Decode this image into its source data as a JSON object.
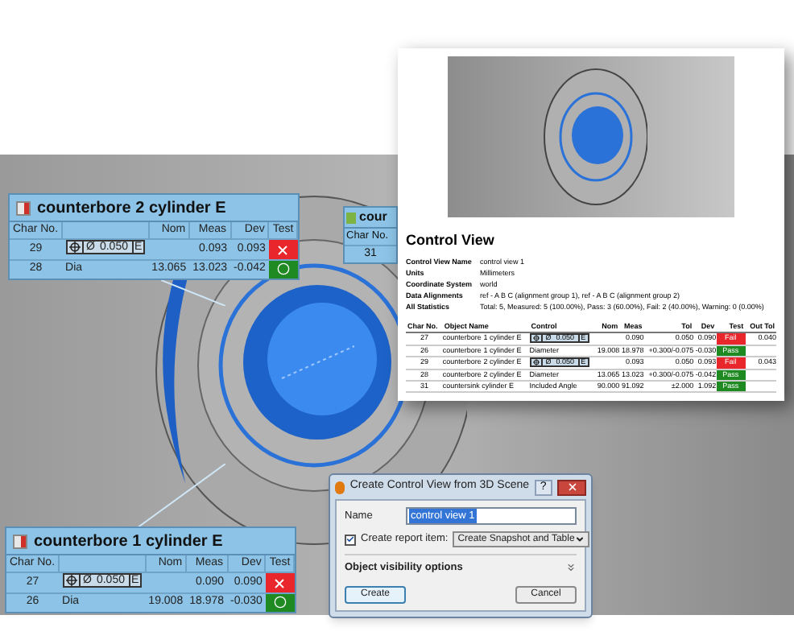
{
  "callouts": [
    {
      "title": "counterbore 2 cylinder E",
      "columns": [
        "Char No.",
        "",
        "Nom",
        "Meas",
        "Dev",
        "Test"
      ],
      "rows": [
        {
          "char": "29",
          "control": {
            "kind": "frame",
            "symbol": "Ø",
            "tolerance": "0.050",
            "modifier": "E"
          },
          "nom": "",
          "meas": "0.093",
          "dev": "0.093",
          "passed": false
        },
        {
          "char": "28",
          "control": {
            "kind": "text",
            "text": "Dia"
          },
          "nom": "13.065",
          "meas": "13.023",
          "dev": "-0.042",
          "passed": true
        }
      ]
    },
    {
      "title": "counterbore 1 cylinder E",
      "columns": [
        "Char No.",
        "",
        "Nom",
        "Meas",
        "Dev",
        "Test"
      ],
      "rows": [
        {
          "char": "27",
          "control": {
            "kind": "frame",
            "symbol": "Ø",
            "tolerance": "0.050",
            "modifier": "E"
          },
          "nom": "",
          "meas": "0.090",
          "dev": "0.090",
          "passed": false
        },
        {
          "char": "26",
          "control": {
            "kind": "text",
            "text": "Dia"
          },
          "nom": "19.008",
          "meas": "18.978",
          "dev": "-0.030",
          "passed": true
        }
      ]
    }
  ],
  "partial_callout": {
    "title": "cour",
    "column": "Char No.",
    "value": "31"
  },
  "report": {
    "heading": "Control View",
    "info": [
      {
        "label": "Control View Name",
        "value": "control view 1"
      },
      {
        "label": "Units",
        "value": "Millimeters"
      },
      {
        "label": "Coordinate System",
        "value": "world"
      },
      {
        "label": "Data Alignments",
        "value": "ref - A B C (alignment group 1), ref - A B C (alignment group 2)"
      },
      {
        "label": "All Statistics",
        "value": "Total: 5, Measured: 5 (100.00%), Pass: 3 (60.00%), Fail: 2 (40.00%), Warning: 0 (0.00%)"
      }
    ],
    "columns": [
      "Char No.",
      "Object Name",
      "Control",
      "Nom",
      "Meas",
      "Tol",
      "Dev",
      "Test",
      "Out Tol"
    ],
    "rows": [
      {
        "char": "27",
        "object": "counterbore 1 cylinder E",
        "control": {
          "kind": "frame",
          "symbol": "Ø",
          "tolerance": "0.050",
          "modifier": "E"
        },
        "nom": "",
        "meas": "0.090",
        "tol": "0.050",
        "dev": "0.090",
        "test": "Fail",
        "passed": false,
        "out_tol": "0.040"
      },
      {
        "char": "26",
        "object": "counterbore 1 cylinder E",
        "control": {
          "kind": "text",
          "text": "Diameter"
        },
        "nom": "19.008",
        "meas": "18.978",
        "tol": "+0.300/-0.075",
        "dev": "-0.030",
        "test": "Pass",
        "passed": true,
        "out_tol": ""
      },
      {
        "char": "29",
        "object": "counterbore 2 cylinder E",
        "control": {
          "kind": "frame",
          "symbol": "Ø",
          "tolerance": "0.050",
          "modifier": "E"
        },
        "nom": "",
        "meas": "0.093",
        "tol": "0.050",
        "dev": "0.093",
        "test": "Fail",
        "passed": false,
        "out_tol": "0.043"
      },
      {
        "char": "28",
        "object": "counterbore 2 cylinder E",
        "control": {
          "kind": "text",
          "text": "Diameter"
        },
        "nom": "13.065",
        "meas": "13.023",
        "tol": "+0.300/-0.075",
        "dev": "-0.042",
        "test": "Pass",
        "passed": true,
        "out_tol": ""
      },
      {
        "char": "31",
        "object": "countersink cylinder E",
        "control": {
          "kind": "text",
          "text": "Included Angle"
        },
        "nom": "90.000",
        "meas": "91.092",
        "tol": "±2.000",
        "dev": "1.092",
        "test": "Pass",
        "passed": true,
        "out_tol": ""
      }
    ]
  },
  "dialog": {
    "title": "Create Control View from 3D Scene",
    "help": "?",
    "name_label": "Name",
    "name_value": "control view 1",
    "report_checkbox": {
      "label": "Create report item:",
      "checked": true
    },
    "report_option": "Create Snapshot and Table",
    "section": "Object visibility options",
    "expanded": false,
    "buttons": [
      "Create",
      "Cancel"
    ]
  }
}
